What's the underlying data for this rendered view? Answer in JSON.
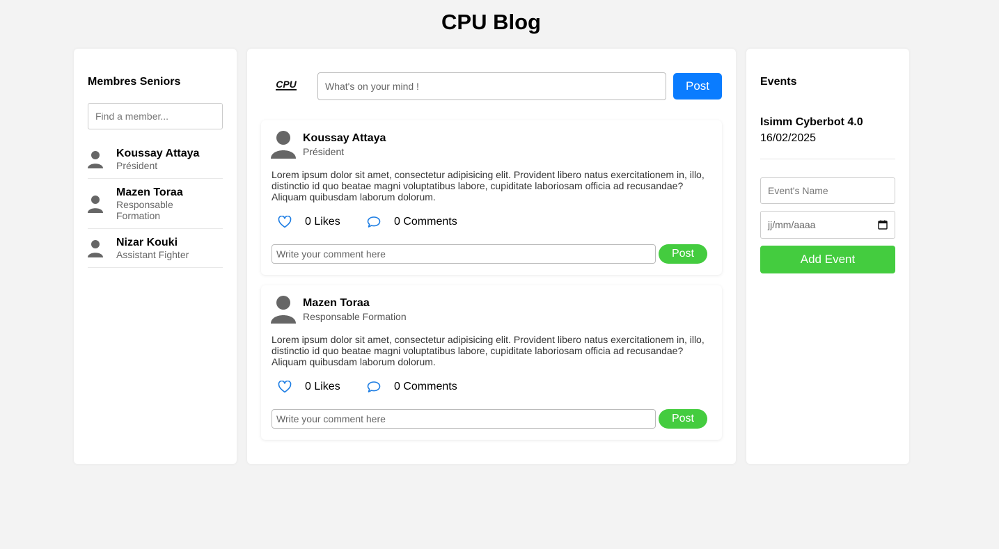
{
  "app": {
    "title": "CPU Blog"
  },
  "sidebar": {
    "heading": "Membres Seniors",
    "search_placeholder": "Find a member...",
    "members": [
      {
        "name": "Koussay Attaya",
        "role": "Président"
      },
      {
        "name": "Mazen Toraa",
        "role": "Responsable Formation"
      },
      {
        "name": "Nizar Kouki",
        "role": "Assistant Fighter"
      }
    ]
  },
  "composer": {
    "logo_text": "CPU",
    "placeholder": "What's on your mind !",
    "post_label": "Post"
  },
  "posts": [
    {
      "author": "Koussay Attaya",
      "role": "Président",
      "body": "Lorem ipsum dolor sit amet, consectetur adipisicing elit. Provident libero natus exercitationem in, illo, distinctio id quo beatae magni voluptatibus labore, cupiditate laboriosam officia ad recusandae? Aliquam quibusdam laborum dolorum.",
      "likes": "0 Likes",
      "comments": "0 Comments",
      "comment_placeholder": "Write your comment here",
      "post_label": "Post"
    },
    {
      "author": "Mazen Toraa",
      "role": "Responsable Formation",
      "body": "Lorem ipsum dolor sit amet, consectetur adipisicing elit. Provident libero natus exercitationem in, illo, distinctio id quo beatae magni voluptatibus labore, cupiditate laboriosam officia ad recusandae? Aliquam quibusdam laborum dolorum.",
      "likes": "0 Likes",
      "comments": "0 Comments",
      "comment_placeholder": "Write your comment here",
      "post_label": "Post"
    }
  ],
  "events": {
    "heading": "Events",
    "items": [
      {
        "name": "Isimm Cyberbot 4.0",
        "date": "16/02/2025"
      }
    ],
    "name_placeholder": "Event's Name",
    "date_placeholder": "jj/mm/aaaa",
    "add_label": "Add Event"
  },
  "colors": {
    "accent_blue": "#0a7cff",
    "accent_green": "#44cc3f",
    "avatar_gray": "#666666",
    "background": "#f3f3f3"
  },
  "icons": {
    "avatar": "user-silhouette-icon",
    "like": "heart-outline-icon",
    "comment": "speech-bubble-icon",
    "calendar": "calendar-icon"
  }
}
